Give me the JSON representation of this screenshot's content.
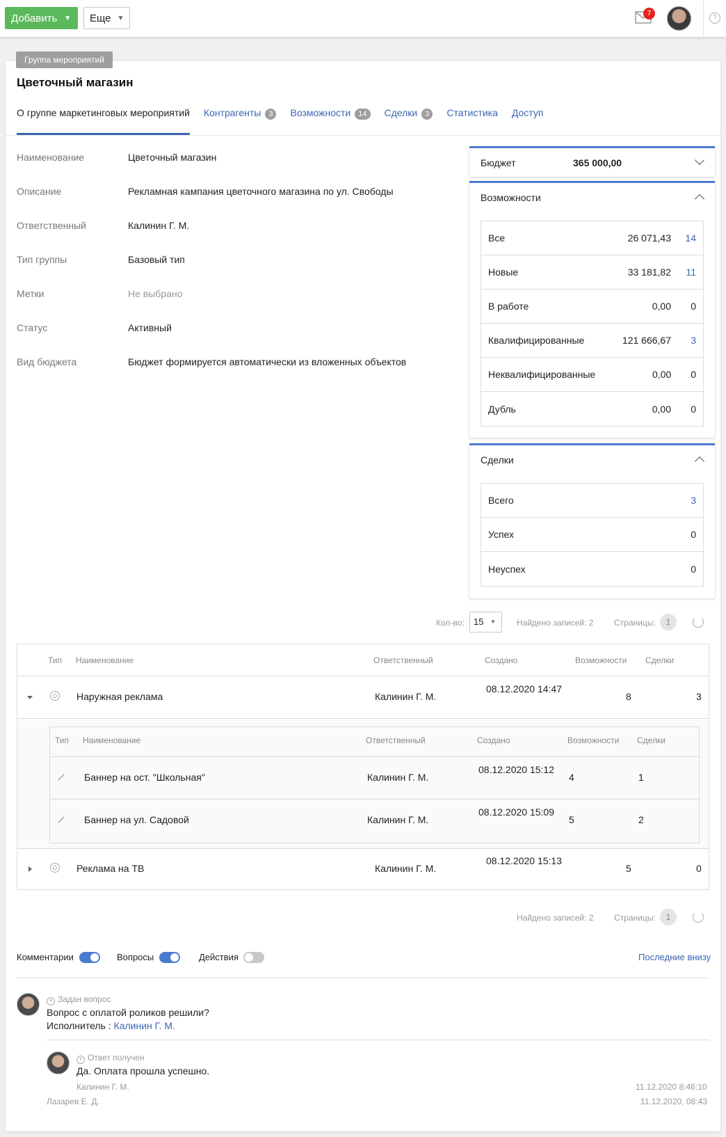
{
  "toolbar": {
    "add_label": "Добавить",
    "more_label": "Еще",
    "mail_count": "7",
    "help_label": "?"
  },
  "group_tag": "Группа мероприятий",
  "title": "Цветочный магазин",
  "tabs": [
    {
      "label": "О группе маркетинговых мероприятий"
    },
    {
      "label": "Контрагенты",
      "count": "3"
    },
    {
      "label": "Возможности",
      "count": "14"
    },
    {
      "label": "Сделки",
      "count": "3"
    },
    {
      "label": "Статистика"
    },
    {
      "label": "Доступ"
    }
  ],
  "details": [
    {
      "label": "Наименование",
      "value": "Цветочный магазин"
    },
    {
      "label": "Описание",
      "value": "Рекламная кампания цветочного магазина по ул. Свободы"
    },
    {
      "label": "Ответственный",
      "value": "Калинин Г. М."
    },
    {
      "label": "Тип группы",
      "value": "Базовый тип"
    },
    {
      "label": "Метки",
      "value": "Не выбрано"
    },
    {
      "label": "Статус",
      "value": "Активный"
    },
    {
      "label": "Вид бюджета",
      "value": "Бюджет формируется автоматически из вложенных объектов"
    }
  ],
  "budget": {
    "label": "Бюджет",
    "value": "365 000,00"
  },
  "opportunities": {
    "title": "Возможности",
    "rows": [
      {
        "label": "Все",
        "value": "26 071,43",
        "count": "14"
      },
      {
        "label": "Новые",
        "value": "33 181,82",
        "count": "11"
      },
      {
        "label": "В работе",
        "value": "0,00",
        "count": "0"
      },
      {
        "label": "Квалифицированные",
        "value": "121 666,67",
        "count": "3"
      },
      {
        "label": "Неквалифицированные",
        "value": "0,00",
        "count": "0"
      },
      {
        "label": "Дубль",
        "value": "0,00",
        "count": "0"
      }
    ]
  },
  "deals": {
    "title": "Сделки",
    "rows": [
      {
        "label": "Всего",
        "count": "3"
      },
      {
        "label": "Успех",
        "count": "0"
      },
      {
        "label": "Неуспех",
        "count": "0"
      }
    ]
  },
  "pager": {
    "qty_label": "Кол-во:",
    "qty_value": "15",
    "found": "Найдено записей: 2",
    "pages_label": "Страницы:",
    "page": "1"
  },
  "table": {
    "headers": {
      "type": "Тип",
      "name": "Наименование",
      "owner": "Ответственный",
      "created": "Создано",
      "opps": "Возможности",
      "deals": "Сделки"
    },
    "rows": [
      {
        "name": "Наружная реклама",
        "owner": "Калинин Г. М.",
        "created": "08.12.2020 14:47",
        "opps": "8",
        "deals": "3"
      },
      {
        "name": "Реклама на ТВ",
        "owner": "Калинин Г. М.",
        "created": "08.12.2020 15:13",
        "opps": "5",
        "deals": "0"
      }
    ],
    "sub_rows": [
      {
        "name": "Баннер на ост. \"Школьная\"",
        "owner": "Калинин Г. М.",
        "created": "08.12.2020 15:12",
        "opps": "4",
        "deals": "1"
      },
      {
        "name": "Баннер на ул. Садовой",
        "owner": "Калинин Г. М.",
        "created": "08.12.2020 15:09",
        "opps": "5",
        "deals": "2"
      }
    ]
  },
  "feed": {
    "toggles": [
      {
        "label": "Комментарии",
        "on": true
      },
      {
        "label": "Вопросы",
        "on": true
      },
      {
        "label": "Действия",
        "on": false
      }
    ],
    "sort_label": "Последние внизу",
    "question": {
      "type": "Задан вопрос",
      "text": "Вопрос с оплатой роликов решили?",
      "executor_label": "Исполнитель :",
      "executor": "Калинин Г. М.",
      "author": "Лазарев Е. Д.",
      "date": "11.12.2020, 08:43"
    },
    "answer": {
      "type": "Ответ получен",
      "text": "Да. Оплата прошла успешно.",
      "author": "Калинин Г. М.",
      "date": "11.12.2020 8:46:10"
    }
  }
}
